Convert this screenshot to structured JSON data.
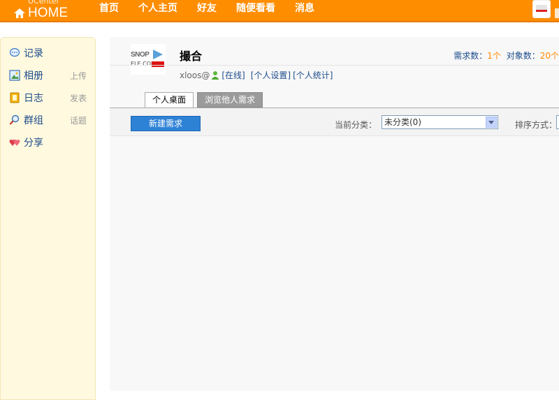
{
  "topbar": {
    "logo_small": "UCenter",
    "logo_big": "HOME",
    "nav": [
      "首页",
      "个人主页",
      "好友",
      "随便看看",
      "消息"
    ]
  },
  "sidebar": {
    "items": [
      {
        "label": "记录",
        "sub": ""
      },
      {
        "label": "相册",
        "sub": "上传"
      },
      {
        "label": "日志",
        "sub": "发表"
      },
      {
        "label": "群组",
        "sub": "话题"
      },
      {
        "label": "分享",
        "sub": ""
      }
    ]
  },
  "profile": {
    "username": "撮合",
    "email": "xloos@",
    "online": "[在线]",
    "settings": "[个人设置]",
    "stats_link": "[个人统计]",
    "pic_text1": "SNOP",
    "pic_text2": "ELE.COM",
    "stats": {
      "req_label": "需求数：",
      "req_value": "1个",
      "obj_label": "对象数：",
      "obj_value": "20个"
    }
  },
  "tabs": [
    "个人桌面",
    "浏览他人需求"
  ],
  "toolbar": {
    "new_button": "新建需求",
    "category_label": "当前分类：",
    "category_value": "未分类(0)",
    "sort_label": "排序方式："
  },
  "colors": {
    "topbar": "#ff8d00",
    "sidebar_bg": "#fff9df",
    "link": "#1c4c8c",
    "button": "#2e82d6"
  }
}
